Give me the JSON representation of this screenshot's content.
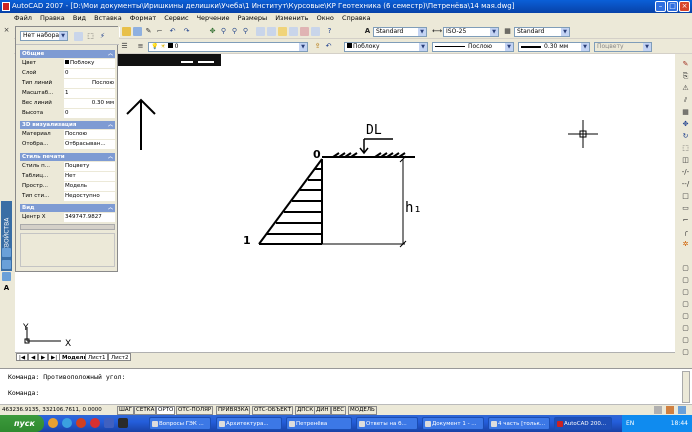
{
  "window": {
    "title": "AutoCAD 2007 - [D:\\Мои документы\\Иришкины делишки\\Учеба\\1 Институт\\Курсовые\\КР Геотехника (6 семестр)\\Петренёва\\14 мая.dwg]"
  },
  "menu": [
    "Файл",
    "Правка",
    "Вид",
    "Вставка",
    "Формат",
    "Сервис",
    "Черчение",
    "Размеры",
    "Изменить",
    "Окно",
    "Справка"
  ],
  "toolbar": {
    "named_view": "Нет набора",
    "text_style": "Standard",
    "dim_style": "ISO-25",
    "table_style": "Standard",
    "layer": "0",
    "color": "Поблоку",
    "linetype": "Послою",
    "lineweight": "0.30 мм",
    "plot_style": "Поцвету"
  },
  "properties": {
    "tab_label": "СВОЙСТВА",
    "sections": {
      "general": "Общие",
      "viz3d": "3D визуализация",
      "print": "Стиль печати",
      "view": "Вид"
    },
    "general": [
      {
        "k": "Цвет",
        "v": "Поблоку"
      },
      {
        "k": "Слой",
        "v": "0"
      },
      {
        "k": "Тип линий",
        "v": "Послою"
      },
      {
        "k": "Масштаб...",
        "v": "1"
      },
      {
        "k": "Вес линий",
        "v": "0.30 мм"
      },
      {
        "k": "Высота",
        "v": "0"
      }
    ],
    "viz3d": [
      {
        "k": "Материал",
        "v": "Послою"
      },
      {
        "k": "Отобра...",
        "v": "Отбрасыван..."
      }
    ],
    "print": [
      {
        "k": "Стиль п...",
        "v": "Поцвету"
      },
      {
        "k": "Таблиц...",
        "v": "Нет"
      },
      {
        "k": "Простр...",
        "v": "Модель"
      },
      {
        "k": "Тип сти...",
        "v": "Недоступно"
      }
    ],
    "view": [
      {
        "k": "Центр X",
        "v": "349747.9827"
      }
    ]
  },
  "drawing": {
    "label_dl": "DL",
    "label_h1": "h₁",
    "label_0": "0",
    "label_1": "1",
    "ucs_y": "Y",
    "ucs_x": "X"
  },
  "tabs": [
    "Модель",
    "Лист1",
    "Лист2"
  ],
  "command": {
    "line1": "Команда: Противоположный угол:",
    "line2": "Команда:"
  },
  "status": {
    "coords": "463236.9135, 332106.7611, 0.0000",
    "buttons": [
      "ШАГ",
      "СЕТКА",
      "ОРТО",
      "ОТС-ПОЛЯР",
      "ПРИВЯЗКА",
      "ОТС-ОБЪЕКТ",
      "ДПСК",
      "ДИН",
      "ВЕС",
      "МОДЕЛЬ"
    ]
  },
  "taskbar": {
    "start": "пуск",
    "tasks": [
      "Вопросы ГЭК ...",
      "Архитектура...",
      "Петренёва",
      "Ответы на б...",
      "Документ 1 - ...",
      "4 часть [тольк...",
      "AutoCAD 200..."
    ],
    "lang": "EN",
    "clock": "18:44"
  },
  "colors": {
    "accent": "#0842a8",
    "section": "#7e9bd3"
  }
}
